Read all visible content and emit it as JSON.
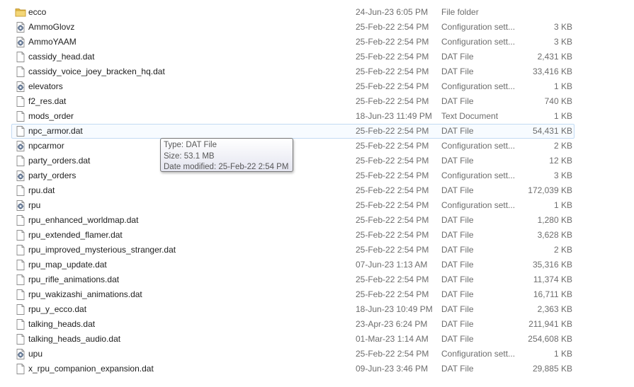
{
  "files": [
    {
      "name": "ecco",
      "date": "24-Jun-23 6:05 PM",
      "type": "File folder",
      "size": "",
      "icon": "folder-icon"
    },
    {
      "name": "AmmoGlovz",
      "date": "25-Feb-22 2:54 PM",
      "type": "Configuration sett...",
      "size": "3 KB",
      "icon": "config-file-icon"
    },
    {
      "name": "AmmoYAAM",
      "date": "25-Feb-22 2:54 PM",
      "type": "Configuration sett...",
      "size": "3 KB",
      "icon": "config-file-icon"
    },
    {
      "name": "cassidy_head.dat",
      "date": "25-Feb-22 2:54 PM",
      "type": "DAT File",
      "size": "2,431 KB",
      "icon": "file-icon"
    },
    {
      "name": "cassidy_voice_joey_bracken_hq.dat",
      "date": "25-Feb-22 2:54 PM",
      "type": "DAT File",
      "size": "33,416 KB",
      "icon": "file-icon"
    },
    {
      "name": "elevators",
      "date": "25-Feb-22 2:54 PM",
      "type": "Configuration sett...",
      "size": "1 KB",
      "icon": "config-file-icon"
    },
    {
      "name": "f2_res.dat",
      "date": "25-Feb-22 2:54 PM",
      "type": "DAT File",
      "size": "740 KB",
      "icon": "file-icon"
    },
    {
      "name": "mods_order",
      "date": "18-Jun-23 11:49 PM",
      "type": "Text Document",
      "size": "1 KB",
      "icon": "file-icon"
    },
    {
      "name": "npc_armor.dat",
      "date": "25-Feb-22 2:54 PM",
      "type": "DAT File",
      "size": "54,431 KB",
      "icon": "file-icon",
      "hover": true
    },
    {
      "name": "npcarmor",
      "date": "25-Feb-22 2:54 PM",
      "type": "Configuration sett...",
      "size": "2 KB",
      "icon": "config-file-icon"
    },
    {
      "name": "party_orders.dat",
      "date": "25-Feb-22 2:54 PM",
      "type": "DAT File",
      "size": "12 KB",
      "icon": "file-icon"
    },
    {
      "name": "party_orders",
      "date": "25-Feb-22 2:54 PM",
      "type": "Configuration sett...",
      "size": "3 KB",
      "icon": "config-file-icon"
    },
    {
      "name": "rpu.dat",
      "date": "25-Feb-22 2:54 PM",
      "type": "DAT File",
      "size": "172,039 KB",
      "icon": "file-icon"
    },
    {
      "name": "rpu",
      "date": "25-Feb-22 2:54 PM",
      "type": "Configuration sett...",
      "size": "1 KB",
      "icon": "config-file-icon"
    },
    {
      "name": "rpu_enhanced_worldmap.dat",
      "date": "25-Feb-22 2:54 PM",
      "type": "DAT File",
      "size": "1,280 KB",
      "icon": "file-icon"
    },
    {
      "name": "rpu_extended_flamer.dat",
      "date": "25-Feb-22 2:54 PM",
      "type": "DAT File",
      "size": "3,628 KB",
      "icon": "file-icon"
    },
    {
      "name": "rpu_improved_mysterious_stranger.dat",
      "date": "25-Feb-22 2:54 PM",
      "type": "DAT File",
      "size": "2 KB",
      "icon": "file-icon"
    },
    {
      "name": "rpu_map_update.dat",
      "date": "07-Jun-23 1:13 AM",
      "type": "DAT File",
      "size": "35,316 KB",
      "icon": "file-icon"
    },
    {
      "name": "rpu_rifle_animations.dat",
      "date": "25-Feb-22 2:54 PM",
      "type": "DAT File",
      "size": "11,374 KB",
      "icon": "file-icon"
    },
    {
      "name": "rpu_wakizashi_animations.dat",
      "date": "25-Feb-22 2:54 PM",
      "type": "DAT File",
      "size": "16,711 KB",
      "icon": "file-icon"
    },
    {
      "name": "rpu_y_ecco.dat",
      "date": "18-Jun-23 10:49 PM",
      "type": "DAT File",
      "size": "2,363 KB",
      "icon": "file-icon"
    },
    {
      "name": "talking_heads.dat",
      "date": "23-Apr-23 6:24 PM",
      "type": "DAT File",
      "size": "211,941 KB",
      "icon": "file-icon"
    },
    {
      "name": "talking_heads_audio.dat",
      "date": "01-Mar-23 1:14 AM",
      "type": "DAT File",
      "size": "254,608 KB",
      "icon": "file-icon"
    },
    {
      "name": "upu",
      "date": "25-Feb-22 2:54 PM",
      "type": "Configuration sett...",
      "size": "1 KB",
      "icon": "config-file-icon"
    },
    {
      "name": "x_rpu_companion_expansion.dat",
      "date": "09-Jun-23 3:46 PM",
      "type": "DAT File",
      "size": "29,885 KB",
      "icon": "file-icon"
    }
  ],
  "tooltip": {
    "type_line": "Type: DAT File",
    "size_line": "Size: 53.1 MB",
    "modified_line": "Date modified: 25-Feb-22 2:54 PM"
  },
  "colors": {
    "hover_border": "#c3dbf3",
    "hover_background": "#f7fbff",
    "secondary_text": "#6d6d6d",
    "folder": "#e8c15a"
  }
}
